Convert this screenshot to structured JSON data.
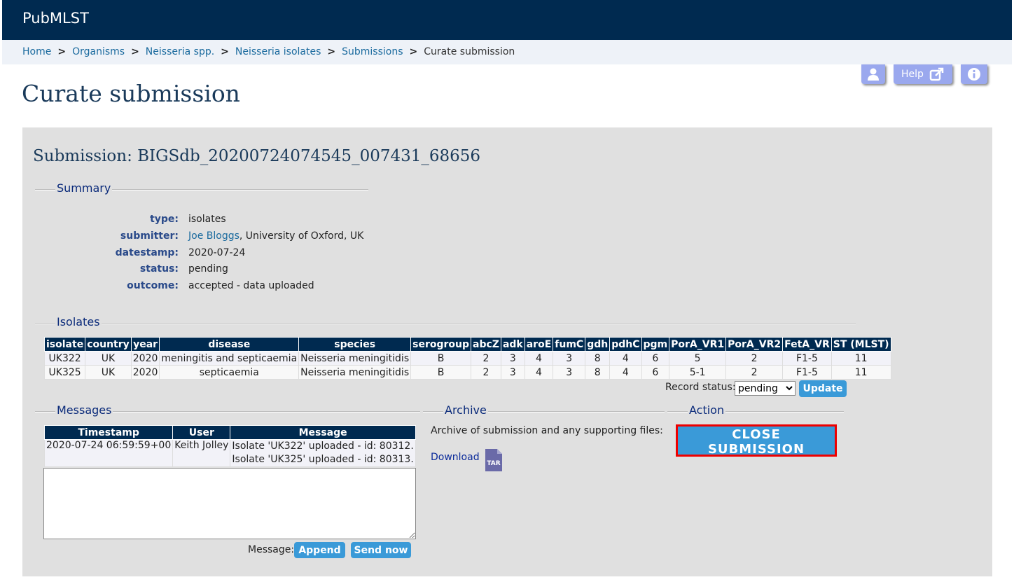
{
  "app": {
    "brand": "PubMLST"
  },
  "breadcrumb": {
    "items": [
      "Home",
      "Organisms",
      "Neisseria spp.",
      "Neisseria isolates",
      "Submissions"
    ],
    "current": "Curate submission",
    "separator": ">"
  },
  "toolbar": {
    "help_label": "Help"
  },
  "page": {
    "title": "Curate submission"
  },
  "submission": {
    "title": "Submission: BIGSdb_20200724074545_007431_68656"
  },
  "summary": {
    "legend": "Summary",
    "fields": [
      {
        "key": "type:",
        "value": "isolates"
      },
      {
        "key": "submitter:",
        "value": ", University of Oxford, UK",
        "link": "Joe Bloggs"
      },
      {
        "key": "datestamp:",
        "value": "2020-07-24"
      },
      {
        "key": "status:",
        "value": "pending"
      },
      {
        "key": "outcome:",
        "value": "accepted - data uploaded"
      }
    ]
  },
  "isolates": {
    "legend": "Isolates",
    "headers": [
      "isolate",
      "country",
      "year",
      "disease",
      "species",
      "serogroup",
      "abcZ",
      "adk",
      "aroE",
      "fumC",
      "gdh",
      "pdhC",
      "pgm",
      "PorA_VR1",
      "PorA_VR2",
      "FetA_VR",
      "ST (MLST)"
    ],
    "rows": [
      [
        "UK322",
        "UK",
        "2020",
        "meningitis and septicaemia",
        "Neisseria meningitidis",
        "B",
        "2",
        "3",
        "4",
        "3",
        "8",
        "4",
        "6",
        "5",
        "2",
        "F1-5",
        "11"
      ],
      [
        "UK325",
        "UK",
        "2020",
        "septicaemia",
        "Neisseria meningitidis",
        "B",
        "2",
        "3",
        "4",
        "3",
        "8",
        "4",
        "6",
        "5-1",
        "2",
        "F1-5",
        "11"
      ]
    ],
    "record_status_label": "Record status:",
    "record_status_value": "pending",
    "update_label": "Update"
  },
  "messages": {
    "legend": "Messages",
    "headers": [
      "Timestamp",
      "User",
      "Message"
    ],
    "rows": [
      {
        "timestamp": "2020-07-24 06:59:59+00",
        "user": "Keith Jolley",
        "lines": [
          "Isolate 'UK322' uploaded - id: 80312.",
          "Isolate 'UK325' uploaded - id: 80313."
        ]
      }
    ],
    "message_label": "Message:",
    "append_label": "Append",
    "send_label": "Send now"
  },
  "archive": {
    "legend": "Archive",
    "description": "Archive of submission and any supporting files:",
    "download_label": "Download",
    "icon_text": "TAR"
  },
  "action": {
    "legend": "Action",
    "close_label": "CLOSE SUBMISSION"
  },
  "colors": {
    "topbar": "#002a50",
    "accent_button": "#3a9ad8",
    "highlight_border": "#ee0000",
    "panel": "#e0e0e0"
  }
}
